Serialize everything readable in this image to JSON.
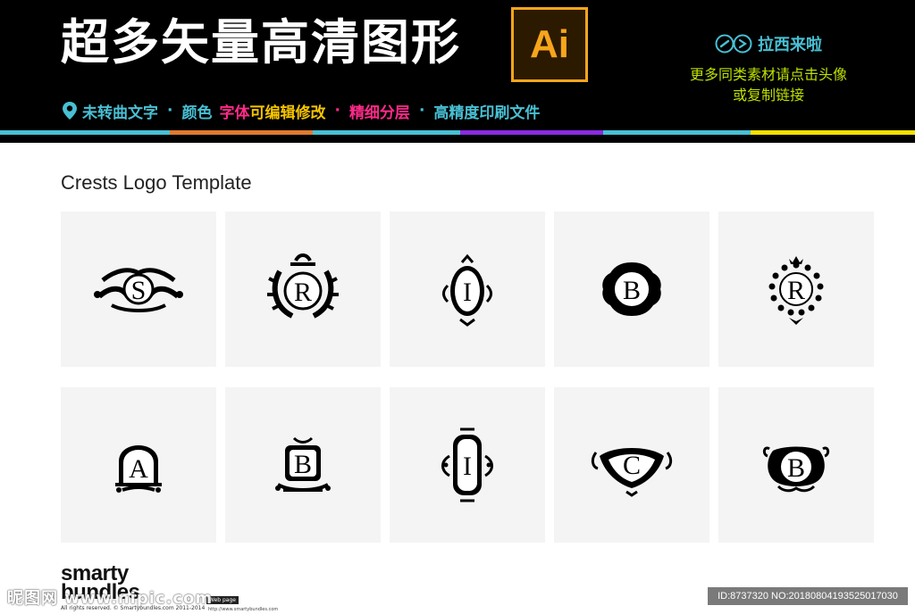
{
  "header": {
    "title": "超多矢量高清图形",
    "badge": "Ai",
    "features": [
      {
        "text": "未转曲文字",
        "color": "#48c0d4"
      },
      {
        "text": "颜色",
        "color": "#48c0d4"
      },
      {
        "text": "字体",
        "color": "#ff2a8a"
      },
      {
        "text": "可编辑修改",
        "color": "#f5c400"
      },
      {
        "text": "精细分层",
        "color": "#ff2a8a"
      },
      {
        "text": "高精度印刷文件",
        "color": "#48c0d4"
      }
    ],
    "brand_name": "拉西来啦",
    "promo_line1": "更多同类素材请点击头像",
    "promo_line2": "或复制链接",
    "stripe_colors": [
      "#48c0d4",
      "#e07a2e",
      "#48c0d4",
      "#8a2be2",
      "#48c0d4",
      "#f5e000"
    ]
  },
  "main": {
    "section_title": "Crests Logo Template",
    "crests": [
      {
        "letter": "S",
        "icon": "scroll-crest-icon"
      },
      {
        "letter": "R",
        "icon": "laurel-crest-icon"
      },
      {
        "letter": "I",
        "icon": "oval-crest-icon"
      },
      {
        "letter": "B",
        "icon": "badge-crest-icon"
      },
      {
        "letter": "R",
        "icon": "pearl-crown-crest-icon"
      },
      {
        "letter": "A",
        "icon": "arch-crest-icon"
      },
      {
        "letter": "B",
        "icon": "square-crest-icon"
      },
      {
        "letter": "I",
        "icon": "frame-crest-icon"
      },
      {
        "letter": "C",
        "icon": "shield-crest-icon"
      },
      {
        "letter": "B",
        "icon": "swirl-crest-icon"
      }
    ]
  },
  "footer": {
    "logo_line1": "smarty",
    "logo_line2": "bundles",
    "rights": "All rights reserved. © Smartybundles.com 2011-2014",
    "webpage_label": "Web page",
    "webpage_url": "http://www.smartybundles.com",
    "watermark": "昵图网 www.nipic.com",
    "id_text": "ID:8737320 NO:20180804193525017030"
  }
}
